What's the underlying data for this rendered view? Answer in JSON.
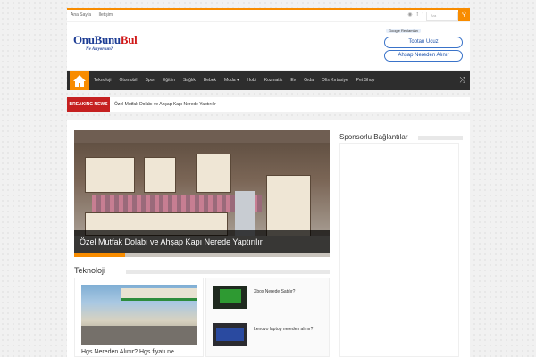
{
  "topbar": {
    "links": [
      "Ana Sayfa",
      "İletişim"
    ],
    "search_placeholder": "Ara",
    "social_icons": [
      "rss-icon",
      "facebook-icon",
      "twitter-icon"
    ]
  },
  "header": {
    "logo_main_1": "OnuBunu",
    "logo_main_2": "Bul",
    "logo_tagline": "Ne Arıyorsun?",
    "ad_label": "Google Reklamları",
    "ad_buttons": [
      "Toptan Ucuz",
      "Ahşap Nereden Alınır"
    ]
  },
  "nav": {
    "items": [
      "Teknoloji",
      "Otomobil",
      "Spor",
      "Eğitim",
      "Sağlık",
      "Bebek",
      "Moda ▾",
      "Hobi",
      "Kozmatik",
      "Ev",
      "Gıda",
      "Ofis Kırtasiye",
      "Pet Shop"
    ]
  },
  "breaking": {
    "label": "BREAKING NEWS",
    "text": "Özel Mutfak Dolabı ve Ahşap Kapı Nerede Yaptırılır"
  },
  "slider": {
    "caption": "Özel Mutfak Dolabı ve Ahşap Kapı Nerede Yaptırılır"
  },
  "section": {
    "title": "Teknoloji",
    "big_post_title": "Hgs Nereden Alınır? Hgs fiyatı ne",
    "side_posts": [
      "Xbox Nerede Satılır?",
      "Lenovo laptop nereden alınır?"
    ]
  },
  "sidebar": {
    "title": "Sponsorlu Bağlantılar"
  },
  "colors": {
    "accent": "#f88c00",
    "nav_bg": "#2d2d2d",
    "breaking": "#c52020"
  }
}
